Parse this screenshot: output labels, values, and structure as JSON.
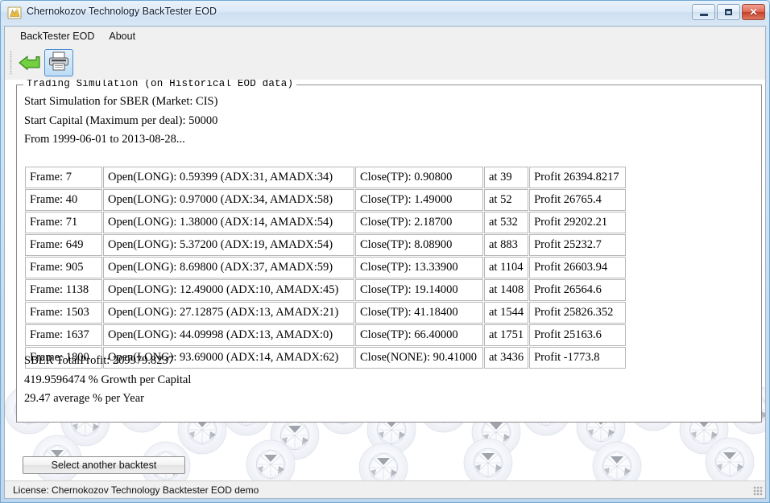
{
  "window": {
    "title": "Chernokozov Technology BackTester EOD",
    "app_icon": "app-star-icon",
    "minimize_label": "Minimize",
    "maximize_label": "Maximize",
    "close_label": "✕"
  },
  "menu": {
    "items": [
      {
        "label": "BackTester EOD"
      },
      {
        "label": "About"
      }
    ]
  },
  "toolbar": {
    "buttons": [
      {
        "name": "back-button",
        "icon": "green-back-arrow-icon",
        "selected": false
      },
      {
        "name": "print-button",
        "icon": "printer-icon",
        "selected": true
      }
    ]
  },
  "group": {
    "legend": "Trading Simulation (on Historical EOD data)"
  },
  "intro": {
    "line1": "Start Simulation for SBER (Market: CIS)",
    "line2": "Start Capital (Maximum per deal): 50000",
    "line3": "From 1999-06-01 to 2013-08-28..."
  },
  "table": {
    "rows": [
      {
        "frame": "Frame: 7",
        "open": "Open(LONG): 0.59399 (ADX:31, AMADX:34)",
        "close": "Close(TP): 0.90800",
        "at": "at 39",
        "profit": "Profit 26394.8217"
      },
      {
        "frame": "Frame: 40",
        "open": "Open(LONG): 0.97000 (ADX:34, AMADX:58)",
        "close": "Close(TP): 1.49000",
        "at": "at 52",
        "profit": "Profit 26765.4"
      },
      {
        "frame": "Frame: 71",
        "open": "Open(LONG): 1.38000 (ADX:14, AMADX:54)",
        "close": "Close(TP): 2.18700",
        "at": "at 532",
        "profit": "Profit 29202.21"
      },
      {
        "frame": "Frame: 649",
        "open": "Open(LONG): 5.37200 (ADX:19, AMADX:54)",
        "close": "Close(TP): 8.08900",
        "at": "at 883",
        "profit": "Profit 25232.7"
      },
      {
        "frame": "Frame: 905",
        "open": "Open(LONG): 8.69800 (ADX:37, AMADX:59)",
        "close": "Close(TP): 13.33900",
        "at": "at 1104",
        "profit": "Profit 26603.94"
      },
      {
        "frame": "Frame: 1138",
        "open": "Open(LONG): 12.49000 (ADX:10, AMADX:45)",
        "close": "Close(TP): 19.14000",
        "at": "at 1408",
        "profit": "Profit 26564.6"
      },
      {
        "frame": "Frame: 1503",
        "open": "Open(LONG): 27.12875 (ADX:13, AMADX:21)",
        "close": "Close(TP): 41.18400",
        "at": "at 1544",
        "profit": "Profit 25826.352"
      },
      {
        "frame": "Frame: 1637",
        "open": "Open(LONG): 44.09998 (ADX:13, AMADX:0)",
        "close": "Close(TP): 66.40000",
        "at": "at 1751",
        "profit": "Profit 25163.6"
      },
      {
        "frame": "Frame: 1800",
        "open": "Open(LONG): 93.69000 (ADX:14, AMADX:62)",
        "close": "Close(NONE): 90.41000",
        "at": "at 3436",
        "profit": "Profit -1773.8"
      }
    ]
  },
  "summary": {
    "line1": "SBER TotalProfit: 209979.8237",
    "line2": "419.9596474 % Growth per Capital",
    "line3": "29.47 average % per Year"
  },
  "actions": {
    "select_backtest_label": "Select another backtest"
  },
  "statusbar": {
    "license": "License: Chernokozov Technology Backtester EOD demo"
  },
  "colors": {
    "frame_border": "#6fa8d4",
    "accent_selected": "#4b8dd0",
    "close_button": "#c43f28",
    "back_arrow": "#5cc02a"
  }
}
